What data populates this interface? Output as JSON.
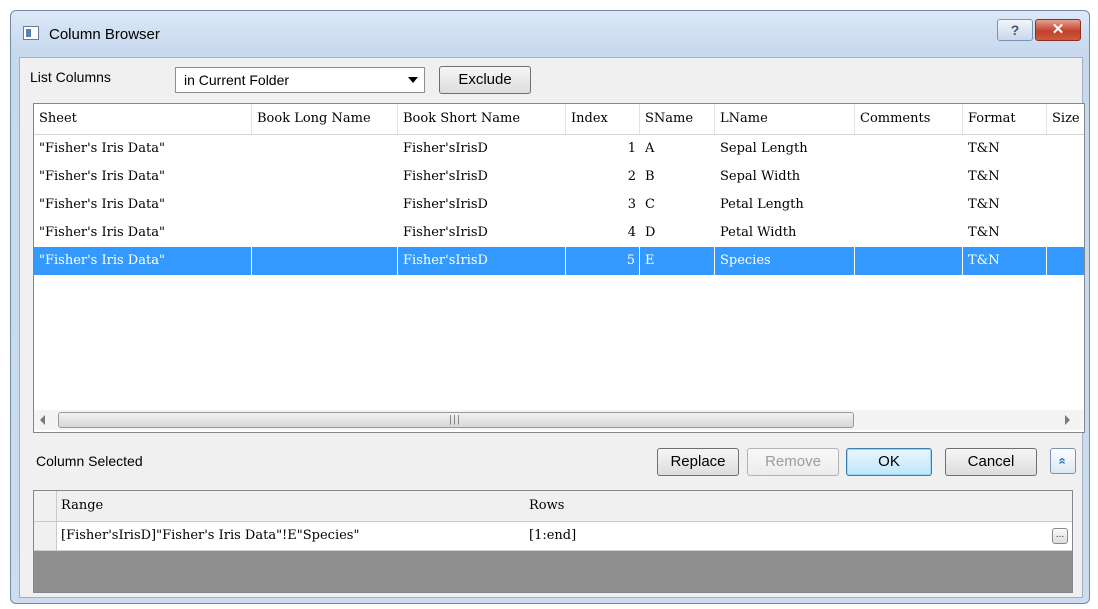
{
  "window": {
    "title": "Column Browser",
    "help_label": "?",
    "close_label": "✕"
  },
  "toolbar": {
    "list_columns_label": "List Columns",
    "scope_value": "in Current Folder",
    "exclude_label": "Exclude"
  },
  "columns_table": {
    "headers": [
      "Sheet",
      "Book Long Name",
      "Book Short Name",
      "Index",
      "SName",
      "LName",
      "Comments",
      "Format",
      "Size"
    ],
    "rows": [
      {
        "sheet": "\"Fisher's Iris Data\"",
        "book_long": "",
        "book_short": "Fisher'sIrisD",
        "index": "1",
        "sname": "A",
        "lname": "Sepal Length",
        "comments": "",
        "format": "T&N",
        "selected": false
      },
      {
        "sheet": "\"Fisher's Iris Data\"",
        "book_long": "",
        "book_short": "Fisher'sIrisD",
        "index": "2",
        "sname": "B",
        "lname": "Sepal Width",
        "comments": "",
        "format": "T&N",
        "selected": false
      },
      {
        "sheet": "\"Fisher's Iris Data\"",
        "book_long": "",
        "book_short": "Fisher'sIrisD",
        "index": "3",
        "sname": "C",
        "lname": "Petal Length",
        "comments": "",
        "format": "T&N",
        "selected": false
      },
      {
        "sheet": "\"Fisher's Iris Data\"",
        "book_long": "",
        "book_short": "Fisher'sIrisD",
        "index": "4",
        "sname": "D",
        "lname": "Petal Width",
        "comments": "",
        "format": "T&N",
        "selected": false
      },
      {
        "sheet": "\"Fisher's Iris Data\"",
        "book_long": "",
        "book_short": "Fisher'sIrisD",
        "index": "5",
        "sname": "E",
        "lname": "Species",
        "comments": "",
        "format": "T&N",
        "selected": true
      }
    ]
  },
  "selection": {
    "label": "Column Selected",
    "replace_label": "Replace",
    "remove_label": "Remove",
    "ok_label": "OK",
    "cancel_label": "Cancel",
    "expand_label": "«"
  },
  "selected_table": {
    "headers": [
      "Range",
      "Rows"
    ],
    "rows": [
      {
        "range": "[Fisher'sIrisD]\"Fisher's Iris Data\"!E\"Species\"",
        "rows": "[1:end]",
        "button": "..."
      }
    ]
  },
  "colors": {
    "selection": "#3399ff",
    "window_frame": "#cddcee"
  }
}
